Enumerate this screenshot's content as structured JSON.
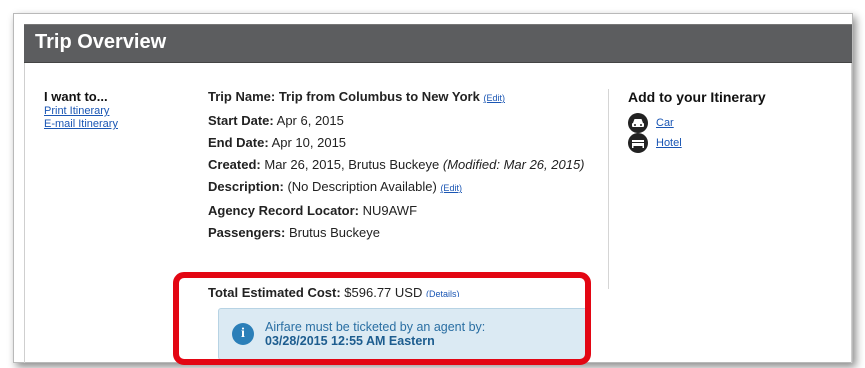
{
  "header": {
    "title": "Trip Overview"
  },
  "left": {
    "heading": "I want to...",
    "links": [
      "Print Itinerary",
      "E-mail Itinerary"
    ]
  },
  "trip": {
    "name_label": "Trip Name:",
    "name_value": "Trip from Columbus to New York",
    "edit_label": "(Edit)",
    "start_label": "Start Date:",
    "start_value": "Apr 6, 2015",
    "end_label": "End Date:",
    "end_value": "Apr 10, 2015",
    "created_label": "Created:",
    "created_value": "Mar 26, 2015, Brutus Buckeye",
    "modified_text": "(Modified: Mar 26, 2015)",
    "description_label": "Description:",
    "description_value": "(No Description Available)",
    "locator_label": "Agency Record Locator:",
    "locator_value": "NU9AWF",
    "passengers_label": "Passengers:",
    "passengers_value": "Brutus Buckeye",
    "cost_label": "Total Estimated Cost:",
    "cost_value": "$596.77",
    "cost_currency": "USD",
    "details_label": "(Details)"
  },
  "right": {
    "heading": "Add to your Itinerary",
    "items": [
      {
        "label": "Car",
        "icon": "car-icon"
      },
      {
        "label": "Hotel",
        "icon": "bed-icon"
      }
    ]
  },
  "alert": {
    "icon": "info-icon",
    "message": "Airfare must be ticketed by an agent by:",
    "deadline": "03/28/2015 12:55 AM Eastern"
  },
  "colors": {
    "title_bar": "#5c5d5f",
    "link": "#1a56b4",
    "alert_bg": "#dbeaf3",
    "alert_icon": "#2b7fb8",
    "highlight": "#e30613"
  }
}
